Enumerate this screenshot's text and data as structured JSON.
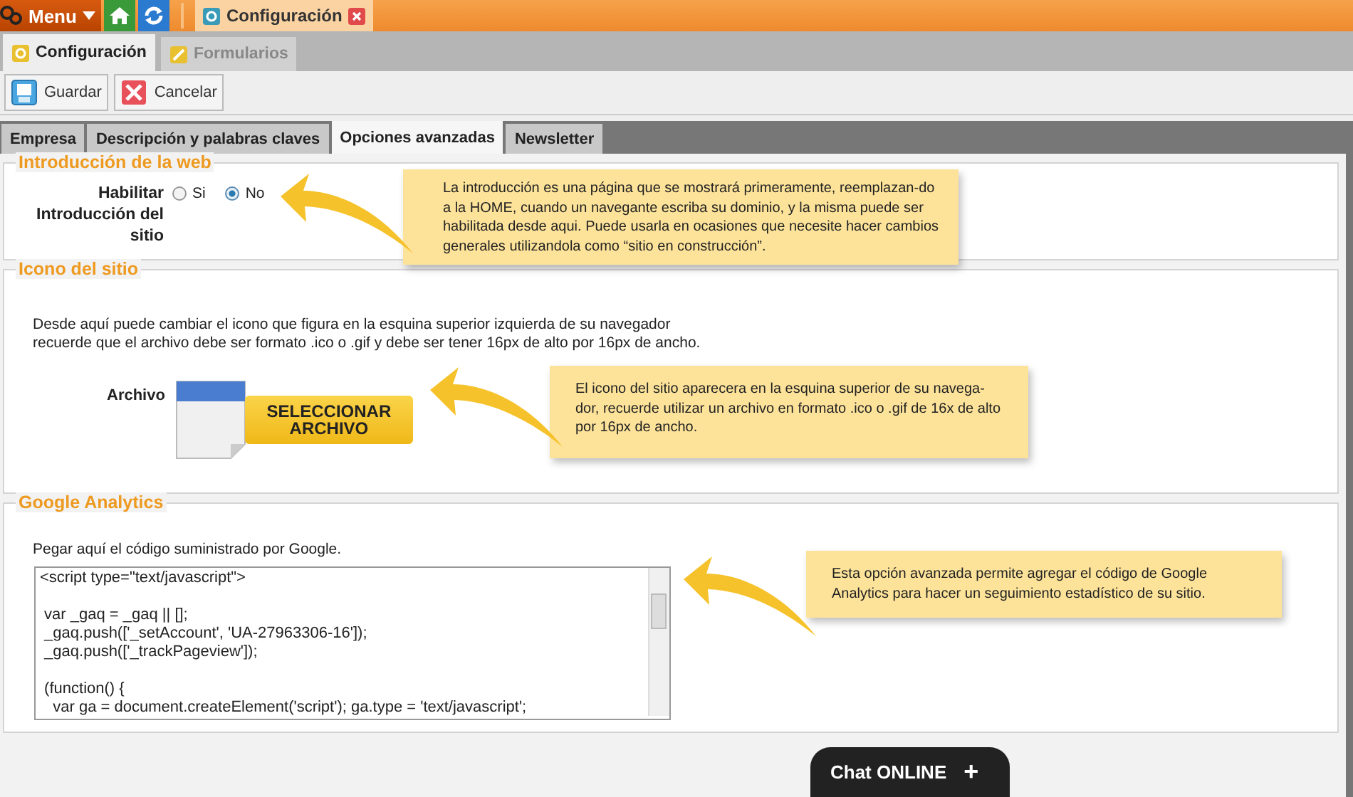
{
  "top_bar": {
    "menu_label": "Menu",
    "open_tabs": [
      {
        "label": "Configuración",
        "selected": true
      }
    ]
  },
  "module_tabs": [
    {
      "label": "Configuración",
      "selected": true
    },
    {
      "label": "Formularios",
      "selected": false
    }
  ],
  "toolbar": {
    "buttons": [
      {
        "kind": "save",
        "label": "Guardar"
      },
      {
        "kind": "cancel",
        "label": "Cancelar"
      }
    ]
  },
  "section_tabs": [
    {
      "label": "Empresa",
      "selected": false
    },
    {
      "label": "Descripción y palabras claves",
      "selected": false
    },
    {
      "label": "Opciones avanzadas",
      "selected": true
    },
    {
      "label": "Newsletter",
      "selected": false
    }
  ],
  "intro": {
    "legend": "Introducción de la web",
    "field_label": "Habilitar Introducción del sitio",
    "options": [
      {
        "label": "Si",
        "selected": false
      },
      {
        "label": "No",
        "selected": true
      }
    ]
  },
  "site_icon": {
    "legend": "Icono del sitio",
    "description_lines": [
      "Desde aquí puede cambiar el icono que figura en la esquina superior izquierda de su navegador",
      "recuerde que el archivo debe ser formato .ico o .gif y debe ser tener  16px de alto por  16px de ancho."
    ],
    "file_label": "Archivo",
    "select_button": "SELECCIONAR ARCHIVO"
  },
  "analytics": {
    "legend": "Google Analytics",
    "hint": "Pegar aquí el código suministrado por Google.",
    "code_blocks": [
      [
        "<script type=\"text/javascript\">"
      ],
      [
        " var _gaq = _gaq || [];",
        " _gaq.push(['_setAccount', 'UA-27963306-16']);",
        " _gaq.push(['_trackPageview']);"
      ],
      [
        " (function() {",
        "   var ga = document.createElement('script'); ga.type = 'text/javascript';"
      ]
    ]
  },
  "callouts": [
    {
      "text": "La introducción es una página que se mostrará primeramente, reemplazan-do a la HOME, cuando un navegante escriba su dominio, y la misma puede ser habilitada desde aqui. Puede usarla en ocasiones que necesite hacer cambios generales utilizandola como “sitio en construcción”."
    },
    {
      "text": "El icono del sitio aparecera en la esquina superior de su navega-dor, recuerde utilizar un archivo en formato .ico o .gif de 16x de alto por 16px de ancho."
    },
    {
      "text": "Esta opción avanzada permite agregar el código de Google Analytics para hacer un seguimiento estadístico de su sitio."
    }
  ],
  "chat": {
    "label": "Chat ONLINE",
    "icon_char": "+"
  }
}
